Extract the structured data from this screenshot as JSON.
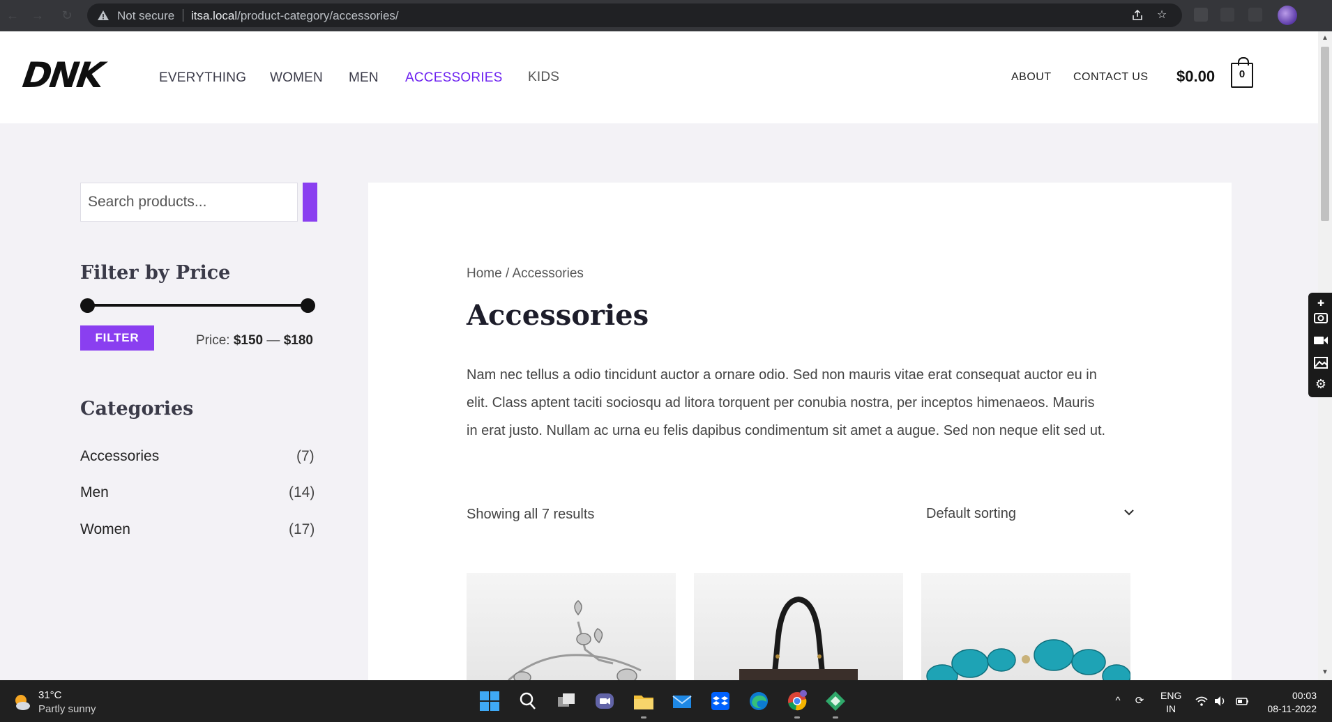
{
  "browser": {
    "security_label": "Not secure",
    "url_host": "itsa.local",
    "url_path": "/product-category/accessories/"
  },
  "header": {
    "logo": "DNK",
    "nav": [
      "EVERYTHING",
      "WOMEN",
      "MEN",
      "ACCESSORIES",
      "KIDS"
    ],
    "active_nav": "ACCESSORIES",
    "secondary_nav": [
      "ABOUT",
      "CONTACT US"
    ],
    "cart_total": "$0.00",
    "cart_count": "0"
  },
  "sidebar": {
    "search_placeholder": "Search products...",
    "filter_title": "Filter by Price",
    "filter_button": "FILTER",
    "price_label": "Price:",
    "price_min": "$150",
    "price_sep": "—",
    "price_max": "$180",
    "categories_title": "Categories",
    "categories": [
      {
        "name": "Accessories",
        "count": "(7)"
      },
      {
        "name": "Men",
        "count": "(14)"
      },
      {
        "name": "Women",
        "count": "(17)"
      }
    ]
  },
  "main": {
    "breadcrumb_home": "Home",
    "breadcrumb_sep": "/",
    "breadcrumb_current": "Accessories",
    "title": "Accessories",
    "description": "Nam nec tellus a odio tincidunt auctor a ornare odio. Sed non mauris vitae erat consequat auctor eu in elit. Class aptent taciti sociosqu ad litora torquent per conubia nostra, per inceptos himenaeos. Mauris in erat justo. Nullam ac urna eu felis dapibus condimentum sit amet a augue. Sed non neque elit sed ut.",
    "results_text": "Showing all 7 results",
    "sorting": "Default sorting",
    "products": [
      "silver-heart-bracelet",
      "black-leather-handbag",
      "turquoise-bead-necklace"
    ]
  },
  "taskbar": {
    "weather_temp": "31°C",
    "weather_desc": "Partly sunny",
    "lang_1": "ENG",
    "lang_2": "IN",
    "time": "00:03",
    "date": "08-11-2022"
  },
  "colors": {
    "accent": "#8a3ff0",
    "nav_active": "#6d22f0",
    "page_bg": "#f3f2f6"
  }
}
